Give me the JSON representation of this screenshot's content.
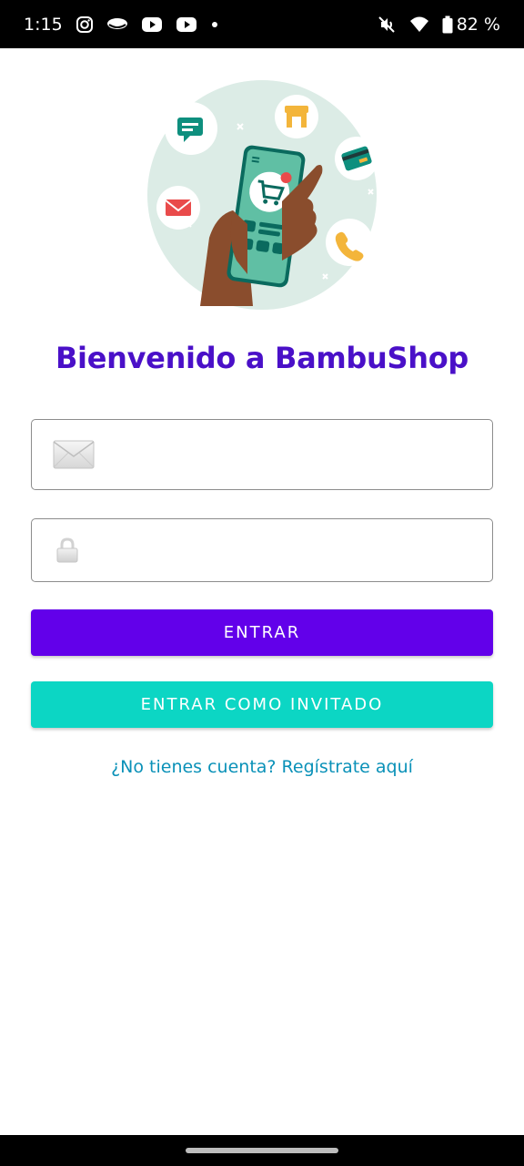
{
  "status_bar": {
    "time": "1:15",
    "battery": "82 %",
    "notification_icons": [
      "instagram-icon",
      "speech-bubble-icon",
      "youtube-icon",
      "youtube-icon",
      "dot-icon"
    ],
    "system_icons": [
      "vibrate-off-icon",
      "wifi-icon",
      "battery-icon"
    ]
  },
  "hero": {
    "icon": "shopping-phone-illustration",
    "circle_color": "#dcece6"
  },
  "welcome_title": "Bienvenido a BambuShop",
  "form": {
    "email_placeholder": "",
    "email_value": "",
    "email_icon": "envelope-icon",
    "password_placeholder": "",
    "password_value": "",
    "password_icon": "lock-icon"
  },
  "buttons": {
    "login_label": "ENTRAR",
    "guest_label": "ENTRAR COMO INVITADO"
  },
  "register_link": "¿No tienes cuenta? Regístrate aquí",
  "colors": {
    "primary": "#6200ea",
    "guest": "#0cd6c4",
    "title": "#4a10c8",
    "link": "#0a91b8"
  }
}
